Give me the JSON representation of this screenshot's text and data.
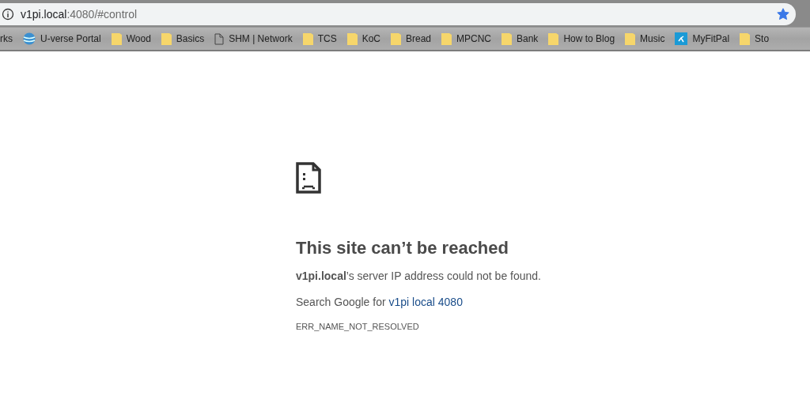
{
  "address_bar": {
    "host": "v1pi.local",
    "rest": ":4080/#control",
    "bookmarked": true
  },
  "bookmarks": [
    {
      "kind": "text",
      "label": "rks"
    },
    {
      "kind": "globe",
      "label": "U-verse Portal"
    },
    {
      "kind": "folder",
      "label": "Wood"
    },
    {
      "kind": "folder",
      "label": "Basics"
    },
    {
      "kind": "page",
      "label": "SHM | Network"
    },
    {
      "kind": "folder",
      "label": "TCS"
    },
    {
      "kind": "folder",
      "label": "KoC"
    },
    {
      "kind": "folder",
      "label": "Bread"
    },
    {
      "kind": "folder",
      "label": "MPCNC"
    },
    {
      "kind": "folder",
      "label": "Bank"
    },
    {
      "kind": "folder",
      "label": "How to Blog"
    },
    {
      "kind": "folder",
      "label": "Music"
    },
    {
      "kind": "app",
      "label": "MyFitPal"
    },
    {
      "kind": "folder",
      "label": "Sto"
    }
  ],
  "error": {
    "title": "This site can’t be reached",
    "message": "**v1pi.local**’s server IP address could not be found.",
    "suggestion_prefix": "Search Google for",
    "suggestion_link": "v1pi local 4080",
    "code": "ERR_NAME_NOT_RESOLVED"
  }
}
